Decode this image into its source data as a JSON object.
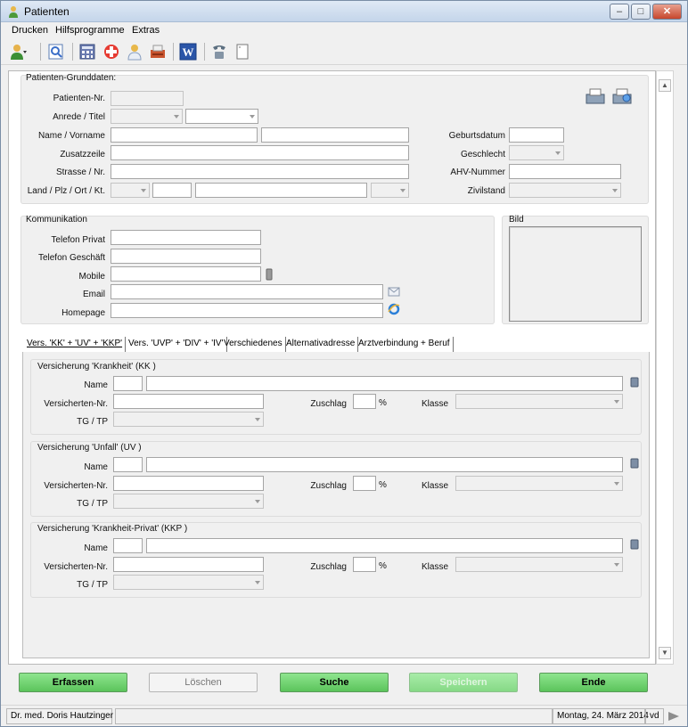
{
  "window": {
    "title": "Patienten"
  },
  "menu": [
    "Drucken",
    "Hilfsprogramme",
    "Extras"
  ],
  "toolbar_icons": [
    "person-dropdown-icon",
    "search-document-icon",
    "calculator-icon",
    "medical-cross-icon",
    "doctor-icon",
    "printer-box-icon",
    "word-icon",
    "phone-icon",
    "blank-document-icon"
  ],
  "grunddaten": {
    "legend": "Patienten-Grunddaten:",
    "patienten_nr": "Patienten-Nr.",
    "anrede": "Anrede / Titel",
    "name": "Name / Vorname",
    "zusatz": "Zusatzzeile",
    "strasse": "Strasse / Nr.",
    "land": "Land / Plz / Ort / Kt.",
    "geburtsdatum": "Geburtsdatum",
    "geschlecht": "Geschlecht",
    "ahv": "AHV-Nummer",
    "zivilstand": "Zivilstand"
  },
  "kommunikation": {
    "legend": "Kommunikation",
    "telefon_privat": "Telefon Privat",
    "telefon_geschaeft": "Telefon Geschäft",
    "mobile": "Mobile",
    "email": "Email",
    "homepage": "Homepage"
  },
  "bild": {
    "legend": "Bild"
  },
  "tabs": [
    "Vers. 'KK' + 'UV' + 'KKP'",
    "Vers. 'UVP' + 'DIV' + 'IV'",
    "Verschiedenes",
    "Alternativadresse",
    "Arztverbindung + Beruf"
  ],
  "versicherungen": [
    {
      "legend": "Versicherung 'Krankheit' (KK )"
    },
    {
      "legend": "Versicherung 'Unfall' (UV )"
    },
    {
      "legend": "Versicherung 'Krankheit-Privat' (KKP )"
    }
  ],
  "vers_labels": {
    "name": "Name",
    "versicherten_nr": "Versicherten-Nr.",
    "tg_tp": "TG / TP",
    "zuschlag": "Zuschlag",
    "percent": "%",
    "klasse": "Klasse"
  },
  "buttons": {
    "erfassen": "Erfassen",
    "loeschen": "Löschen",
    "suche": "Suche",
    "speichern": "Speichern",
    "ende": "Ende"
  },
  "status": {
    "user": "Dr. med. Doris Hautzinger",
    "date": "Montag, 24. März 2014",
    "code": "vd"
  }
}
